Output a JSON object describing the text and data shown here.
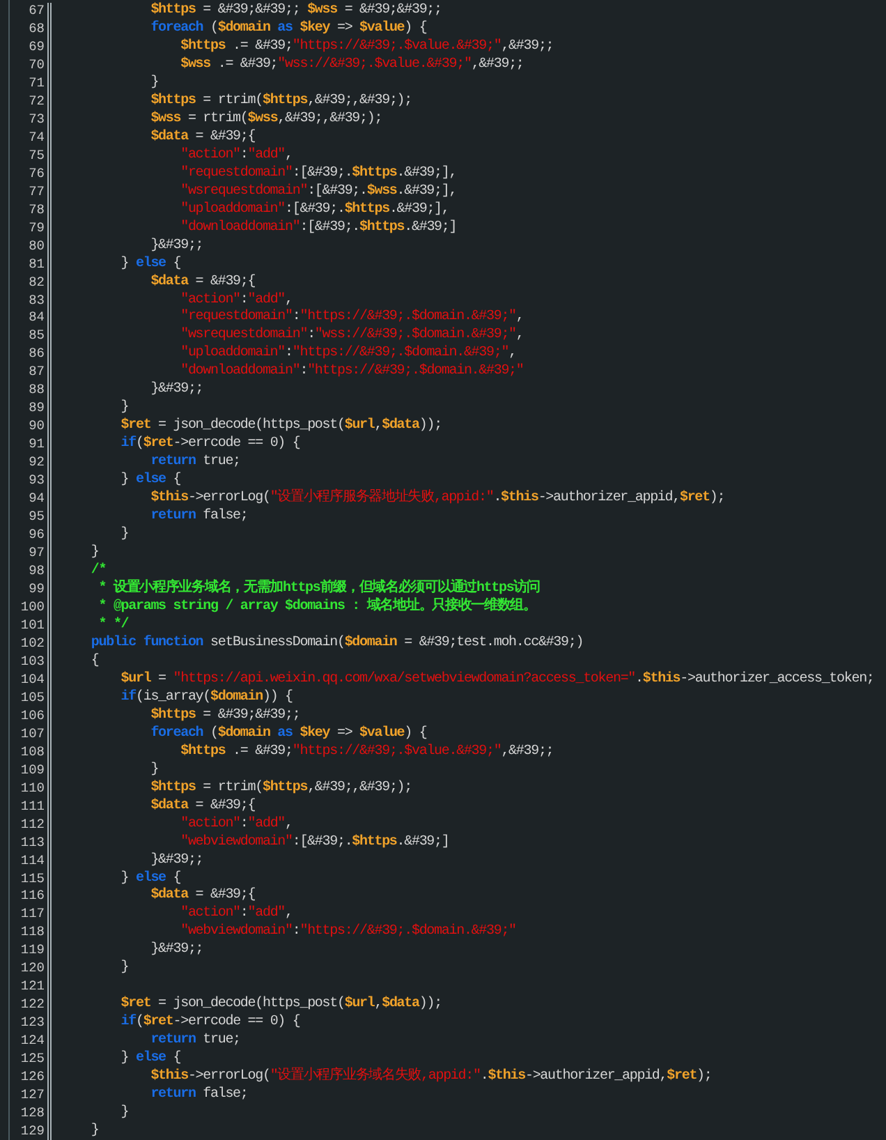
{
  "editor": {
    "lines": [
      {
        "n": "67",
        "t": [
          {
            "kind": "var",
            "text": "            $https"
          },
          {
            "kind": "plain",
            "text": " = &#39;&#39;; "
          },
          {
            "kind": "var",
            "text": "$wss"
          },
          {
            "kind": "plain",
            "text": " = &#39;&#39;;"
          }
        ]
      },
      {
        "n": "68",
        "t": [
          {
            "kind": "keyword",
            "text": "            foreach"
          },
          {
            "kind": "plain",
            "text": " ("
          },
          {
            "kind": "var",
            "text": "$domain"
          },
          {
            "kind": "keyword",
            "text": " as "
          },
          {
            "kind": "var",
            "text": "$key"
          },
          {
            "kind": "plain",
            "text": " => "
          },
          {
            "kind": "var",
            "text": "$value"
          },
          {
            "kind": "plain",
            "text": ") {"
          }
        ]
      },
      {
        "n": "69",
        "t": [
          {
            "kind": "var",
            "text": "                $https"
          },
          {
            "kind": "plain",
            "text": " .= &#39;"
          },
          {
            "kind": "string",
            "text": "\"https://&#39;.$value.&#39;\""
          },
          {
            "kind": "plain",
            "text": ",&#39;;"
          }
        ]
      },
      {
        "n": "70",
        "t": [
          {
            "kind": "var",
            "text": "                $wss"
          },
          {
            "kind": "plain",
            "text": " .= &#39;"
          },
          {
            "kind": "string",
            "text": "\"wss://&#39;.$value.&#39;\""
          },
          {
            "kind": "plain",
            "text": ",&#39;;"
          }
        ]
      },
      {
        "n": "71",
        "t": [
          {
            "kind": "plain",
            "text": "            }"
          }
        ]
      },
      {
        "n": "72",
        "t": [
          {
            "kind": "var",
            "text": "            $https"
          },
          {
            "kind": "plain",
            "text": " = rtrim("
          },
          {
            "kind": "var",
            "text": "$https"
          },
          {
            "kind": "plain",
            "text": ",&#39;,&#39;);"
          }
        ]
      },
      {
        "n": "73",
        "t": [
          {
            "kind": "var",
            "text": "            $wss"
          },
          {
            "kind": "plain",
            "text": " = rtrim("
          },
          {
            "kind": "var",
            "text": "$wss"
          },
          {
            "kind": "plain",
            "text": ",&#39;,&#39;);"
          }
        ]
      },
      {
        "n": "74",
        "t": [
          {
            "kind": "var",
            "text": "            $data"
          },
          {
            "kind": "plain",
            "text": " = &#39;{"
          }
        ]
      },
      {
        "n": "75",
        "t": [
          {
            "kind": "string",
            "text": "                \"action\""
          },
          {
            "kind": "plain",
            "text": ":"
          },
          {
            "kind": "string",
            "text": "\"add\""
          },
          {
            "kind": "plain",
            "text": ","
          }
        ]
      },
      {
        "n": "76",
        "t": [
          {
            "kind": "string",
            "text": "                \"requestdomain\""
          },
          {
            "kind": "plain",
            "text": ":[&#39;."
          },
          {
            "kind": "var",
            "text": "$https"
          },
          {
            "kind": "plain",
            "text": ".&#39;],"
          }
        ]
      },
      {
        "n": "77",
        "t": [
          {
            "kind": "string",
            "text": "                \"wsrequestdomain\""
          },
          {
            "kind": "plain",
            "text": ":[&#39;."
          },
          {
            "kind": "var",
            "text": "$wss"
          },
          {
            "kind": "plain",
            "text": ".&#39;],"
          }
        ]
      },
      {
        "n": "78",
        "t": [
          {
            "kind": "string",
            "text": "                \"uploaddomain\""
          },
          {
            "kind": "plain",
            "text": ":[&#39;."
          },
          {
            "kind": "var",
            "text": "$https"
          },
          {
            "kind": "plain",
            "text": ".&#39;],"
          }
        ]
      },
      {
        "n": "79",
        "t": [
          {
            "kind": "string",
            "text": "                \"downloaddomain\""
          },
          {
            "kind": "plain",
            "text": ":[&#39;."
          },
          {
            "kind": "var",
            "text": "$https"
          },
          {
            "kind": "plain",
            "text": ".&#39;]"
          }
        ]
      },
      {
        "n": "80",
        "t": [
          {
            "kind": "plain",
            "text": "            }&#39;;"
          }
        ]
      },
      {
        "n": "81",
        "t": [
          {
            "kind": "plain",
            "text": "        } "
          },
          {
            "kind": "keyword",
            "text": "else"
          },
          {
            "kind": "plain",
            "text": " {"
          }
        ]
      },
      {
        "n": "82",
        "t": [
          {
            "kind": "var",
            "text": "            $data"
          },
          {
            "kind": "plain",
            "text": " = &#39;{"
          }
        ]
      },
      {
        "n": "83",
        "t": [
          {
            "kind": "string",
            "text": "                \"action\""
          },
          {
            "kind": "plain",
            "text": ":"
          },
          {
            "kind": "string",
            "text": "\"add\""
          },
          {
            "kind": "plain",
            "text": ","
          }
        ]
      },
      {
        "n": "84",
        "t": [
          {
            "kind": "string",
            "text": "                \"requestdomain\""
          },
          {
            "kind": "plain",
            "text": ":"
          },
          {
            "kind": "string",
            "text": "\"https://&#39;.$domain.&#39;\""
          },
          {
            "kind": "plain",
            "text": ","
          }
        ]
      },
      {
        "n": "85",
        "t": [
          {
            "kind": "string",
            "text": "                \"wsrequestdomain\""
          },
          {
            "kind": "plain",
            "text": ":"
          },
          {
            "kind": "string",
            "text": "\"wss://&#39;.$domain.&#39;\""
          },
          {
            "kind": "plain",
            "text": ","
          }
        ]
      },
      {
        "n": "86",
        "t": [
          {
            "kind": "string",
            "text": "                \"uploaddomain\""
          },
          {
            "kind": "plain",
            "text": ":"
          },
          {
            "kind": "string",
            "text": "\"https://&#39;.$domain.&#39;\""
          },
          {
            "kind": "plain",
            "text": ","
          }
        ]
      },
      {
        "n": "87",
        "t": [
          {
            "kind": "string",
            "text": "                \"downloaddomain\""
          },
          {
            "kind": "plain",
            "text": ":"
          },
          {
            "kind": "string",
            "text": "\"https://&#39;.$domain.&#39;\""
          }
        ]
      },
      {
        "n": "88",
        "t": [
          {
            "kind": "plain",
            "text": "            }&#39;;"
          }
        ]
      },
      {
        "n": "89",
        "t": [
          {
            "kind": "plain",
            "text": "        }"
          }
        ]
      },
      {
        "n": "90",
        "t": [
          {
            "kind": "var",
            "text": "        $ret"
          },
          {
            "kind": "plain",
            "text": " = json_decode(https_post("
          },
          {
            "kind": "var",
            "text": "$url"
          },
          {
            "kind": "plain",
            "text": ","
          },
          {
            "kind": "var",
            "text": "$data"
          },
          {
            "kind": "plain",
            "text": "));"
          }
        ]
      },
      {
        "n": "91",
        "t": [
          {
            "kind": "keyword",
            "text": "        if"
          },
          {
            "kind": "plain",
            "text": "("
          },
          {
            "kind": "var",
            "text": "$ret"
          },
          {
            "kind": "plain",
            "text": "->errcode == 0) {"
          }
        ]
      },
      {
        "n": "92",
        "t": [
          {
            "kind": "keyword",
            "text": "            return"
          },
          {
            "kind": "plain",
            "text": " true;"
          }
        ]
      },
      {
        "n": "93",
        "t": [
          {
            "kind": "plain",
            "text": "        } "
          },
          {
            "kind": "keyword",
            "text": "else"
          },
          {
            "kind": "plain",
            "text": " {"
          }
        ]
      },
      {
        "n": "94",
        "t": [
          {
            "kind": "var",
            "text": "            $this"
          },
          {
            "kind": "plain",
            "text": "->errorLog("
          },
          {
            "kind": "string",
            "text": "\"设置小程序服务器地址失败,appid:\""
          },
          {
            "kind": "plain",
            "text": "."
          },
          {
            "kind": "var",
            "text": "$this"
          },
          {
            "kind": "plain",
            "text": "->authorizer_appid,"
          },
          {
            "kind": "var",
            "text": "$ret"
          },
          {
            "kind": "plain",
            "text": ");"
          }
        ]
      },
      {
        "n": "95",
        "t": [
          {
            "kind": "keyword",
            "text": "            return"
          },
          {
            "kind": "plain",
            "text": " false;"
          }
        ]
      },
      {
        "n": "96",
        "t": [
          {
            "kind": "plain",
            "text": "        }"
          }
        ]
      },
      {
        "n": "97",
        "t": [
          {
            "kind": "plain",
            "text": "    }"
          }
        ]
      },
      {
        "n": "98",
        "t": [
          {
            "kind": "comment",
            "text": "    /*"
          }
        ]
      },
      {
        "n": "99",
        "t": [
          {
            "kind": "comment",
            "text": "     * 设置小程序业务域名，无需加https前缀，但域名必须可以通过https访问"
          }
        ]
      },
      {
        "n": "100",
        "t": [
          {
            "kind": "comment",
            "text": "     * @params string / array $domains : 域名地址。只接收一维数组。"
          }
        ]
      },
      {
        "n": "101",
        "t": [
          {
            "kind": "comment",
            "text": "     * */"
          }
        ]
      },
      {
        "n": "102",
        "t": [
          {
            "kind": "keyword",
            "text": "    public function"
          },
          {
            "kind": "plain",
            "text": " setBusinessDomain("
          },
          {
            "kind": "var",
            "text": "$domain"
          },
          {
            "kind": "plain",
            "text": " = &#39;test.moh.cc&#39;)"
          }
        ]
      },
      {
        "n": "103",
        "t": [
          {
            "kind": "plain",
            "text": "    {"
          }
        ]
      },
      {
        "n": "104",
        "t": [
          {
            "kind": "var",
            "text": "        $url"
          },
          {
            "kind": "plain",
            "text": " = "
          },
          {
            "kind": "string",
            "text": "\"https://api.weixin.qq.com/wxa/setwebviewdomain?access_token=\""
          },
          {
            "kind": "plain",
            "text": "."
          },
          {
            "kind": "var",
            "text": "$this"
          },
          {
            "kind": "plain",
            "text": "->authorizer_access_token;"
          }
        ]
      },
      {
        "n": "105",
        "t": [
          {
            "kind": "keyword",
            "text": "        if"
          },
          {
            "kind": "plain",
            "text": "(is_array("
          },
          {
            "kind": "var",
            "text": "$domain"
          },
          {
            "kind": "plain",
            "text": ")) {"
          }
        ]
      },
      {
        "n": "106",
        "t": [
          {
            "kind": "var",
            "text": "            $https"
          },
          {
            "kind": "plain",
            "text": " = &#39;&#39;;"
          }
        ]
      },
      {
        "n": "107",
        "t": [
          {
            "kind": "keyword",
            "text": "            foreach"
          },
          {
            "kind": "plain",
            "text": " ("
          },
          {
            "kind": "var",
            "text": "$domain"
          },
          {
            "kind": "keyword",
            "text": " as "
          },
          {
            "kind": "var",
            "text": "$key"
          },
          {
            "kind": "plain",
            "text": " => "
          },
          {
            "kind": "var",
            "text": "$value"
          },
          {
            "kind": "plain",
            "text": ") {"
          }
        ]
      },
      {
        "n": "108",
        "t": [
          {
            "kind": "var",
            "text": "                $https"
          },
          {
            "kind": "plain",
            "text": " .= &#39;"
          },
          {
            "kind": "string",
            "text": "\"https://&#39;.$value.&#39;\""
          },
          {
            "kind": "plain",
            "text": ",&#39;;"
          }
        ]
      },
      {
        "n": "109",
        "t": [
          {
            "kind": "plain",
            "text": "            }"
          }
        ]
      },
      {
        "n": "110",
        "t": [
          {
            "kind": "var",
            "text": "            $https"
          },
          {
            "kind": "plain",
            "text": " = rtrim("
          },
          {
            "kind": "var",
            "text": "$https"
          },
          {
            "kind": "plain",
            "text": ",&#39;,&#39;);"
          }
        ]
      },
      {
        "n": "111",
        "t": [
          {
            "kind": "var",
            "text": "            $data"
          },
          {
            "kind": "plain",
            "text": " = &#39;{"
          }
        ]
      },
      {
        "n": "112",
        "t": [
          {
            "kind": "string",
            "text": "                \"action\""
          },
          {
            "kind": "plain",
            "text": ":"
          },
          {
            "kind": "string",
            "text": "\"add\""
          },
          {
            "kind": "plain",
            "text": ","
          }
        ]
      },
      {
        "n": "113",
        "t": [
          {
            "kind": "string",
            "text": "                \"webviewdomain\""
          },
          {
            "kind": "plain",
            "text": ":[&#39;."
          },
          {
            "kind": "var",
            "text": "$https"
          },
          {
            "kind": "plain",
            "text": ".&#39;]"
          }
        ]
      },
      {
        "n": "114",
        "t": [
          {
            "kind": "plain",
            "text": "            }&#39;;"
          }
        ]
      },
      {
        "n": "115",
        "t": [
          {
            "kind": "plain",
            "text": "        } "
          },
          {
            "kind": "keyword",
            "text": "else"
          },
          {
            "kind": "plain",
            "text": " {"
          }
        ]
      },
      {
        "n": "116",
        "t": [
          {
            "kind": "var",
            "text": "            $data"
          },
          {
            "kind": "plain",
            "text": " = &#39;{"
          }
        ]
      },
      {
        "n": "117",
        "t": [
          {
            "kind": "string",
            "text": "                \"action\""
          },
          {
            "kind": "plain",
            "text": ":"
          },
          {
            "kind": "string",
            "text": "\"add\""
          },
          {
            "kind": "plain",
            "text": ","
          }
        ]
      },
      {
        "n": "118",
        "t": [
          {
            "kind": "string",
            "text": "                \"webviewdomain\""
          },
          {
            "kind": "plain",
            "text": ":"
          },
          {
            "kind": "string",
            "text": "\"https://&#39;.$domain.&#39;\""
          }
        ]
      },
      {
        "n": "119",
        "t": [
          {
            "kind": "plain",
            "text": "            }&#39;;"
          }
        ]
      },
      {
        "n": "120",
        "t": [
          {
            "kind": "plain",
            "text": "        }"
          }
        ]
      },
      {
        "n": "121"
      },
      {
        "n": "122",
        "t": [
          {
            "kind": "var",
            "text": "        $ret"
          },
          {
            "kind": "plain",
            "text": " = json_decode(https_post("
          },
          {
            "kind": "var",
            "text": "$url"
          },
          {
            "kind": "plain",
            "text": ","
          },
          {
            "kind": "var",
            "text": "$data"
          },
          {
            "kind": "plain",
            "text": "));"
          }
        ]
      },
      {
        "n": "123",
        "t": [
          {
            "kind": "keyword",
            "text": "        if"
          },
          {
            "kind": "plain",
            "text": "("
          },
          {
            "kind": "var",
            "text": "$ret"
          },
          {
            "kind": "plain",
            "text": "->errcode == 0) {"
          }
        ]
      },
      {
        "n": "124",
        "t": [
          {
            "kind": "keyword",
            "text": "            return"
          },
          {
            "kind": "plain",
            "text": " true;"
          }
        ]
      },
      {
        "n": "125",
        "t": [
          {
            "kind": "plain",
            "text": "        } "
          },
          {
            "kind": "keyword",
            "text": "else"
          },
          {
            "kind": "plain",
            "text": " {"
          }
        ]
      },
      {
        "n": "126",
        "t": [
          {
            "kind": "var",
            "text": "            $this"
          },
          {
            "kind": "plain",
            "text": "->errorLog("
          },
          {
            "kind": "string",
            "text": "\"设置小程序业务域名失败,appid:\""
          },
          {
            "kind": "plain",
            "text": "."
          },
          {
            "kind": "var",
            "text": "$this"
          },
          {
            "kind": "plain",
            "text": "->authorizer_appid,"
          },
          {
            "kind": "var",
            "text": "$ret"
          },
          {
            "kind": "plain",
            "text": ");"
          }
        ]
      },
      {
        "n": "127",
        "t": [
          {
            "kind": "keyword",
            "text": "            return"
          },
          {
            "kind": "plain",
            "text": " false;"
          }
        ]
      },
      {
        "n": "128",
        "t": [
          {
            "kind": "plain",
            "text": "        }"
          }
        ]
      },
      {
        "n": "129",
        "t": [
          {
            "kind": "plain",
            "text": "    }"
          }
        ]
      }
    ]
  }
}
